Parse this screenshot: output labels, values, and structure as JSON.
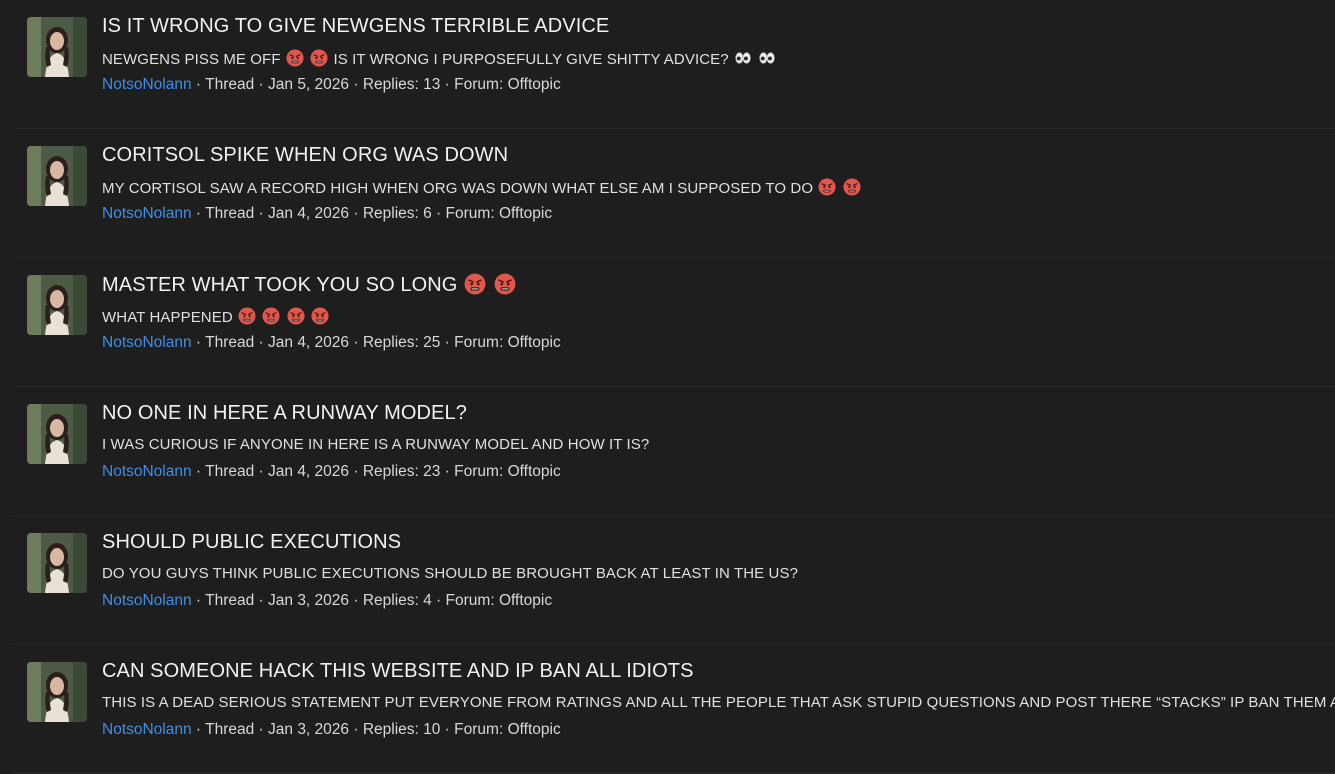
{
  "threads": [
    {
      "title": "IS IT WRONG TO GIVE NEWGENS TERRIBLE ADVICE",
      "title_emojis": [],
      "snippet_a": "NEWGENS PISS ME OFF",
      "snippet_a_emojis": [
        "angry-face-icon",
        "angry-face-icon"
      ],
      "snippet_b": "IS IT WRONG I PURPOSEFULLY GIVE SHITTY ADVICE?",
      "snippet_b_emojis": [
        "eyes-icon",
        "eyes-icon"
      ],
      "author": "NotsoNolann",
      "type": "Thread",
      "date": "Jan 5, 2026",
      "replies_label": "Replies:",
      "replies": "13",
      "forum_label": "Forum:",
      "forum": "Offtopic"
    },
    {
      "title": "CORITSOL SPIKE WHEN ORG WAS DOWN",
      "title_emojis": [],
      "snippet_a": "MY CORTISOL SAW A RECORD HIGH WHEN ORG WAS DOWN WHAT ELSE AM I SUPPOSED TO DO",
      "snippet_a_emojis": [
        "angry-face-icon",
        "angry-face-icon"
      ],
      "snippet_b": "",
      "snippet_b_emojis": [],
      "author": "NotsoNolann",
      "type": "Thread",
      "date": "Jan 4, 2026",
      "replies_label": "Replies:",
      "replies": "6",
      "forum_label": "Forum:",
      "forum": "Offtopic"
    },
    {
      "title": "MASTER WHAT TOOK YOU SO LONG",
      "title_emojis": [
        "angry-face-icon",
        "angry-face-icon"
      ],
      "snippet_a": "WHAT HAPPENED",
      "snippet_a_emojis": [
        "angry-face-icon",
        "angry-face-icon",
        "angry-face-icon",
        "angry-face-icon"
      ],
      "snippet_b": "",
      "snippet_b_emojis": [],
      "author": "NotsoNolann",
      "type": "Thread",
      "date": "Jan 4, 2026",
      "replies_label": "Replies:",
      "replies": "25",
      "forum_label": "Forum:",
      "forum": "Offtopic"
    },
    {
      "title": "NO ONE IN HERE A RUNWAY MODEL?",
      "title_emojis": [],
      "snippet_a": "I WAS CURIOUS IF ANYONE IN HERE IS A RUNWAY MODEL AND HOW IT IS?",
      "snippet_a_emojis": [],
      "snippet_b": "",
      "snippet_b_emojis": [],
      "author": "NotsoNolann",
      "type": "Thread",
      "date": "Jan 4, 2026",
      "replies_label": "Replies:",
      "replies": "23",
      "forum_label": "Forum:",
      "forum": "Offtopic"
    },
    {
      "title": "SHOULD PUBLIC EXECUTIONS",
      "title_emojis": [],
      "snippet_a": "DO YOU GUYS THINK PUBLIC EXECUTIONS SHOULD BE BROUGHT BACK AT LEAST IN THE US?",
      "snippet_a_emojis": [],
      "snippet_b": "",
      "snippet_b_emojis": [],
      "author": "NotsoNolann",
      "type": "Thread",
      "date": "Jan 3, 2026",
      "replies_label": "Replies:",
      "replies": "4",
      "forum_label": "Forum:",
      "forum": "Offtopic"
    },
    {
      "title": "CAN SOMEONE HACK THIS WEBSITE AND IP BAN ALL IDIOTS",
      "title_emojis": [],
      "snippet_a": "THIS IS A DEAD SERIOUS STATEMENT PUT EVERYONE FROM RATINGS AND ALL THE PEOPLE THAT ASK STUPID QUESTIONS AND POST THERE “STACKS” IP BAN THEM ALL.",
      "snippet_a_emojis": [],
      "snippet_b": "",
      "snippet_b_emojis": [],
      "author": "NotsoNolann",
      "type": "Thread",
      "date": "Jan 3, 2026",
      "replies_label": "Replies:",
      "replies": "10",
      "forum_label": "Forum:",
      "forum": "Offtopic"
    }
  ],
  "colors": {
    "background": "#1e1e1f",
    "link": "#3d8fe8",
    "divider": "#2a2a2b"
  }
}
